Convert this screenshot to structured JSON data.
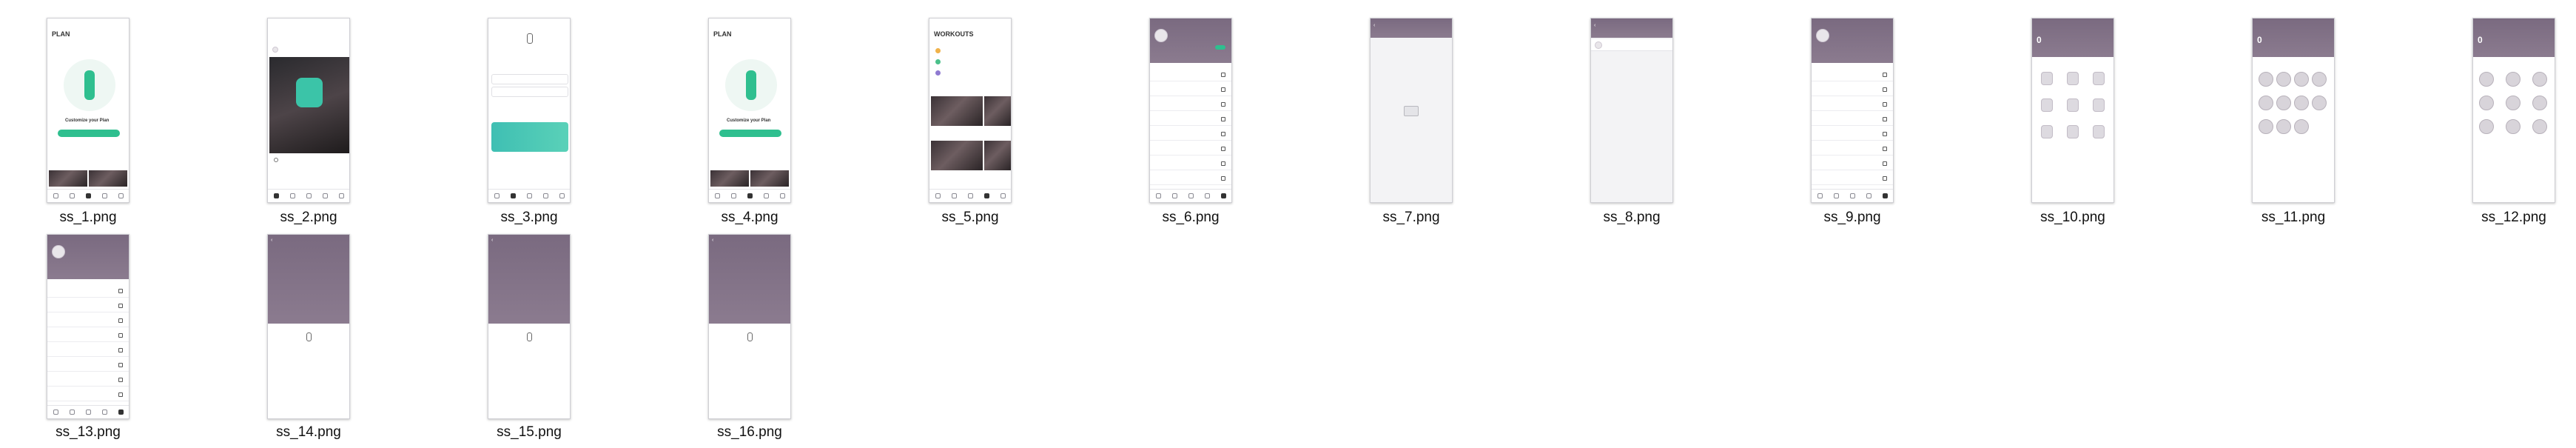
{
  "captions": [
    "ss_1.png",
    "ss_2.png",
    "ss_3.png",
    "ss_4.png",
    "ss_5.png",
    "ss_6.png",
    "ss_7.png",
    "ss_8.png",
    "ss_9.png",
    "ss_10.png",
    "ss_11.png",
    "ss_12.png",
    "ss_13.png",
    "ss_14.png",
    "ss_15.png",
    "ss_16.png"
  ],
  "screens": {
    "plan_title": "PLAN",
    "plan_headline": "Customize your Plan",
    "workouts_title": "WORKOUTS",
    "stat_value": "0"
  },
  "colors": {
    "accent_green": "#2fbf8f",
    "header_purple": "#7a6a80"
  }
}
